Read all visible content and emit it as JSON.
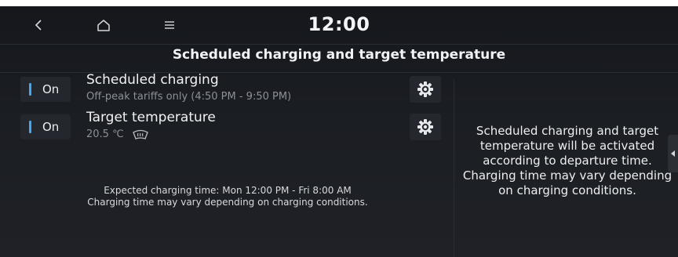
{
  "header": {
    "time": "12:00",
    "icons": [
      "back-icon",
      "home-icon",
      "menu-icon"
    ]
  },
  "page": {
    "title": "Scheduled charging and target temperature"
  },
  "rows": [
    {
      "toggle_label": "On",
      "title": "Scheduled charging",
      "subtitle": "Off-peak tariffs only (4:50 PM - 9:50 PM)",
      "settings_icon": "gear-icon"
    },
    {
      "toggle_label": "On",
      "title": "Target temperature",
      "subtitle": "20.5 ℃",
      "extra_icon": "defrost-icon",
      "settings_icon": "gear-icon"
    }
  ],
  "info": {
    "line1": "Expected charging time: Mon 12:00 PM - Fri 8:00 AM",
    "line2": "Charging time may vary depending on charging conditions."
  },
  "side_panel": {
    "text": "Scheduled charging and target temperature will be activated according to departure time. Charging time may vary depending on charging conditions."
  },
  "colors": {
    "accent": "#3fa9f5",
    "background": "#1b1e23",
    "button": "#24272d"
  }
}
